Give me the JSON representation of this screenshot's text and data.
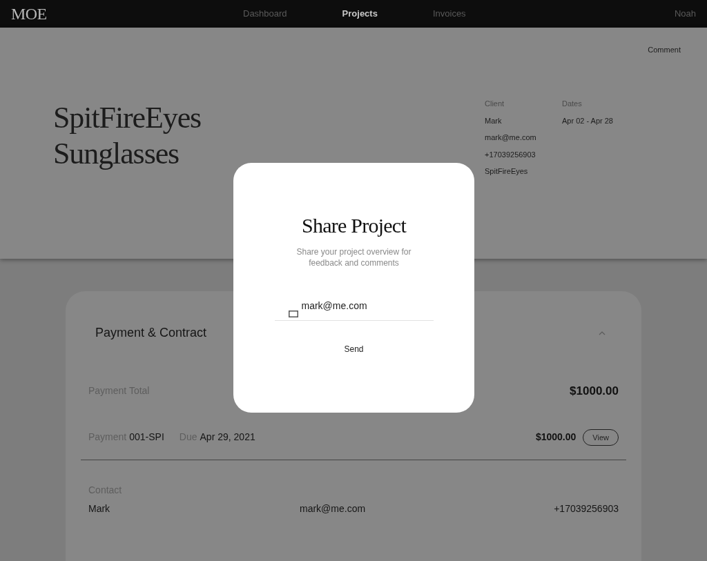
{
  "nav": {
    "logo": "MOE",
    "items": [
      {
        "label": "Dashboard",
        "selected": false
      },
      {
        "label": "Projects",
        "selected": true
      },
      {
        "label": "Invoices",
        "selected": false
      }
    ],
    "user": "Noah"
  },
  "project": {
    "comment": "Comment",
    "title": "SpitFireEyes Sunglasses",
    "client_label": "Client",
    "client": [
      "Mark",
      "mark@me.com",
      "+17039256903",
      "SpitFireEyes"
    ],
    "dates_label": "Dates",
    "dates": "Apr 02 - Apr 28"
  },
  "card": {
    "title": "Payment & Contract",
    "expanded": true,
    "payment_total_label": "Payment Total",
    "payment_total": "$1000.00",
    "payment": {
      "label": "Payment",
      "number": "001-SPI",
      "due_label": "Due",
      "due": "Apr 29, 2021",
      "amount": "$1000.00",
      "button": "View"
    },
    "contact": {
      "label": "Contact",
      "name": "Mark",
      "email": "mark@me.com",
      "phone": "+17039256903"
    }
  },
  "modal": {
    "title": "Share Project",
    "subtitle": "Share your project overview for feedback and comments",
    "email": "mark@me.com",
    "button": "Send"
  }
}
